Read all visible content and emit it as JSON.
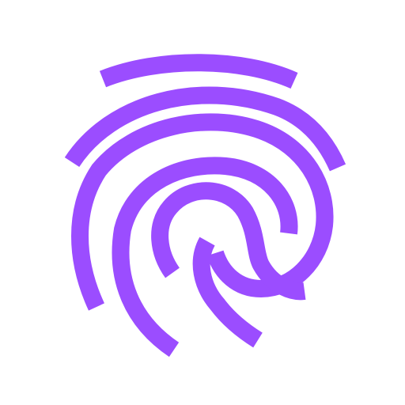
{
  "icon": {
    "name": "fingerprint-icon",
    "color": "#9b4dff",
    "background": "#ffffff"
  }
}
